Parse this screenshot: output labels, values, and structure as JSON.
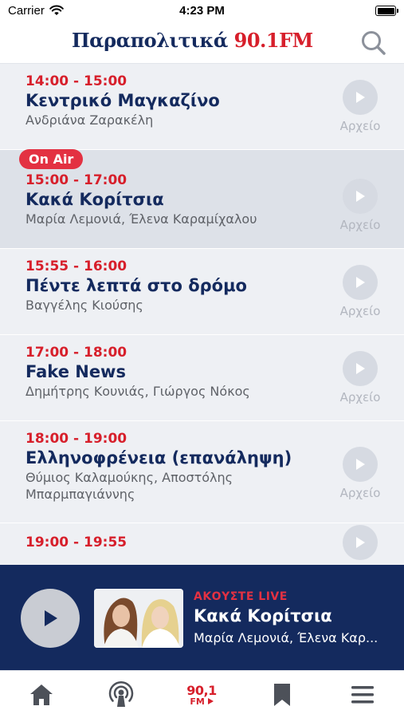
{
  "status_bar": {
    "carrier": "Carrier",
    "time": "4:23 PM"
  },
  "header": {
    "brand_name": "Παραπολιτικά",
    "brand_freq": "90.1FM",
    "search_icon": "search-icon"
  },
  "schedule": {
    "archive_label": "Αρχείο",
    "onair_label": "On Air",
    "items": [
      {
        "time": "14:00 - 15:00",
        "title": "Κεντρικό Μαγκαζίνο",
        "hosts": "Ανδριάνα Ζαρακέλη",
        "live": false
      },
      {
        "time": "15:00 - 17:00",
        "title": "Κακά Κορίτσια",
        "hosts": "Μαρία Λεμονιά, Έλενα Καραμίχαλου",
        "live": true
      },
      {
        "time": "15:55 - 16:00",
        "title": "Πέντε λεπτά στο δρόμο",
        "hosts": "Βαγγέλης Κιούσης",
        "live": false
      },
      {
        "time": "17:00 - 18:00",
        "title": "Fake News",
        "hosts": "Δημήτρης Κουνιάς, Γιώργος Νόκος",
        "live": false
      },
      {
        "time": "18:00 - 19:00",
        "title": "Ελληνοφρένεια (επανάληψη)",
        "hosts_lines": [
          "Θύμιος Καλαμούκης, Αποστόλης",
          "Μπαρμπαγιάννης"
        ],
        "live": false
      },
      {
        "time": "19:00 - 19:55",
        "live": false
      }
    ]
  },
  "player": {
    "live_label": "ΑΚΟΥΣΤΕ LIVE",
    "title": "Κακά Κορίτσια",
    "hosts": "Μαρία Λεμονιά, Έλενα Καρ..."
  },
  "tabbar": {
    "logo_top": "90,1",
    "logo_bottom": "FM",
    "icons": [
      "home-icon",
      "broadcast-icon",
      "radio-logo-icon",
      "bookmark-icon",
      "menu-icon"
    ]
  },
  "colors": {
    "brand_navy": "#142a5e",
    "accent_red": "#d71f2b",
    "onair_red": "#e33142",
    "list_bg": "#eef0f4",
    "live_row_bg": "#dde1e8"
  }
}
